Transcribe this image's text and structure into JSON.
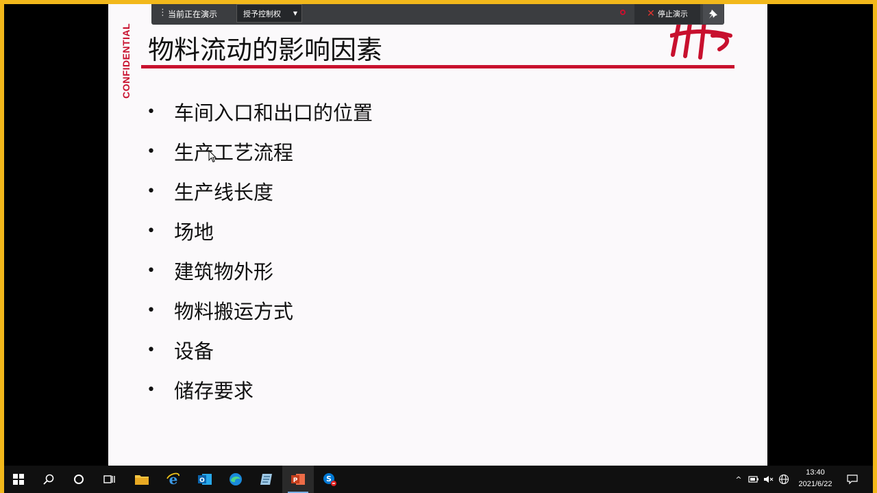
{
  "presenter_bar": {
    "status_text": "当前正在演示",
    "control_label": "授予控制权",
    "stop_label": "停止演示"
  },
  "slide": {
    "confidential": "CONFIDENTIAL",
    "title": "物料流动的影响因素",
    "bullet_glyph": "•",
    "bullets": [
      "车间入口和出口的位置",
      "生产工艺流程",
      "生产线长度",
      "场地",
      "建筑物外形",
      "物料搬运方式",
      "设备",
      "储存要求"
    ],
    "accent_color": "#c8102e"
  },
  "taskbar": {
    "apps": [
      "windows-start",
      "search",
      "cortana",
      "task-view",
      "file-explorer",
      "internet-explorer",
      "outlook",
      "edge",
      "notepad",
      "powerpoint",
      "skype"
    ],
    "clock_time": "13:40",
    "clock_date": "2021/6/22"
  },
  "colors": {
    "share_border": "#f2b81b",
    "taskbar": "#101010"
  }
}
